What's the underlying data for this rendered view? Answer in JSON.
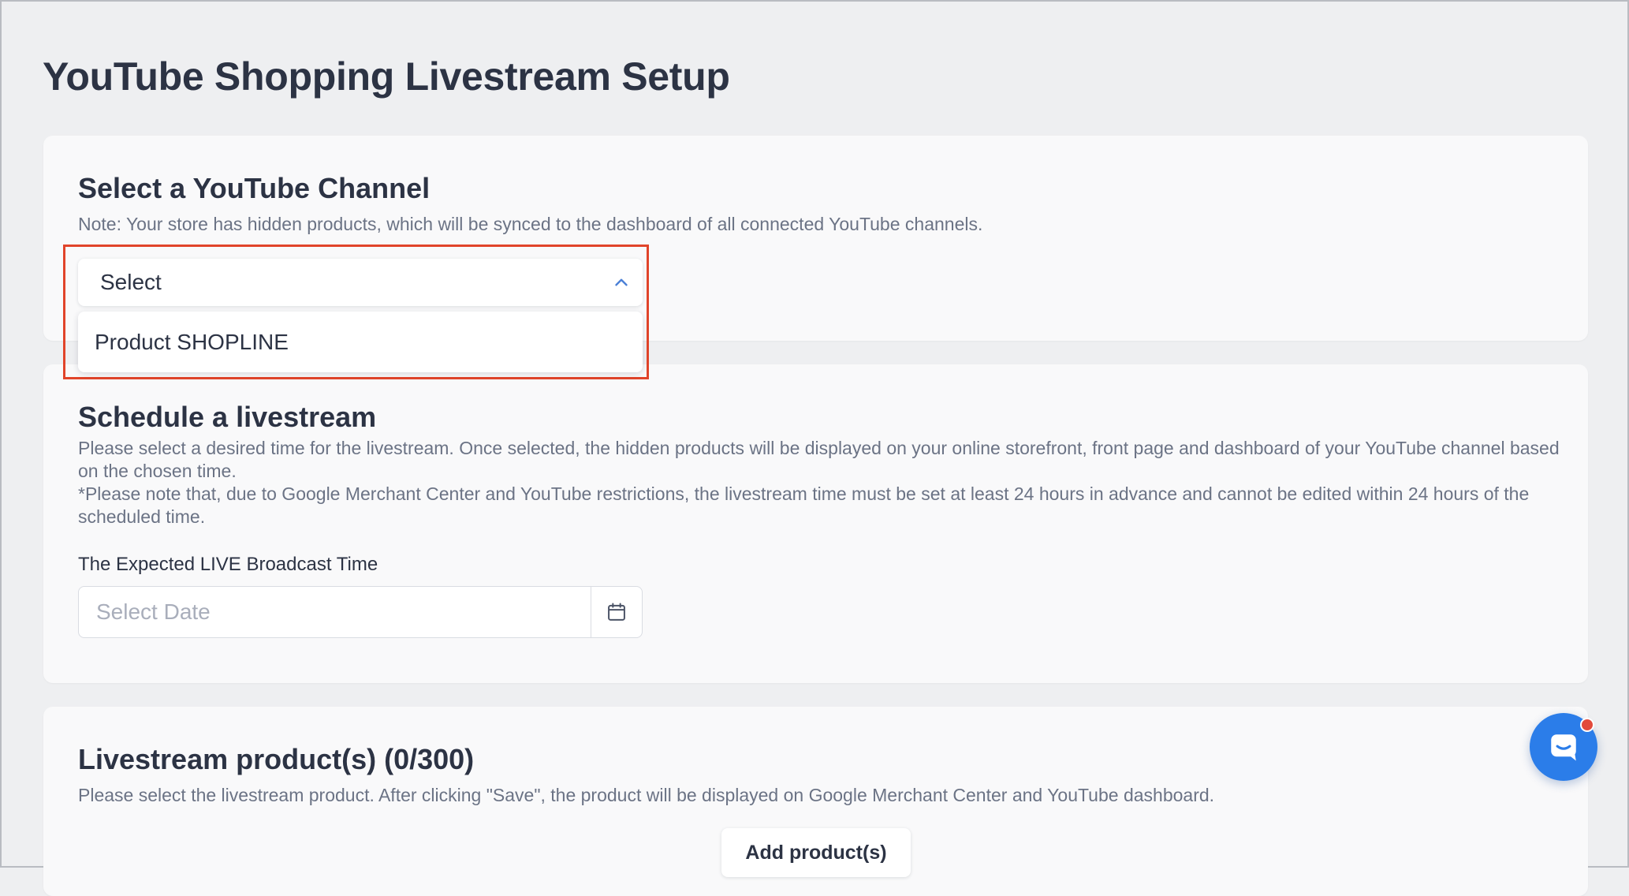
{
  "page": {
    "title": "YouTube Shopping Livestream Setup"
  },
  "channel_section": {
    "title": "Select a YouTube Channel",
    "note": "Note: Your store has hidden products, which will be synced to the dashboard of all connected YouTube channels.",
    "select": {
      "value": "Select",
      "state": "open",
      "icon": "chevron-up-icon",
      "options": [
        "Product SHOPLINE"
      ]
    }
  },
  "schedule_section": {
    "title": "Schedule a livestream",
    "description": "Please select a desired time for the livestream. Once selected, the hidden products will be displayed on your online storefront, front page and dashboard of your YouTube channel based on the chosen time.",
    "restriction_note": "*Please note that, due to Google Merchant Center and YouTube restrictions, the livestream time must be set at least 24 hours in advance and cannot be edited within 24 hours of the scheduled time.",
    "field_label": "The Expected LIVE Broadcast Time",
    "date_input": {
      "value": "",
      "placeholder": "Select Date"
    },
    "calendar_icon": "calendar-icon"
  },
  "products_section": {
    "title": "Livestream product(s) (0/300)",
    "description": "Please select the livestream product. After clicking \"Save\", the product will be displayed on Google Merchant Center and YouTube dashboard.",
    "add_button_label": "Add product(s)"
  },
  "chat": {
    "icon": "chat-icon",
    "has_notification": true
  },
  "colors": {
    "page_background": "#eeeff1",
    "card_background": "#f9f9fa",
    "highlight": "#e1442a",
    "accent": "#2b7de9",
    "chevron": "#4a7fd6",
    "notification": "#e24a3b"
  }
}
